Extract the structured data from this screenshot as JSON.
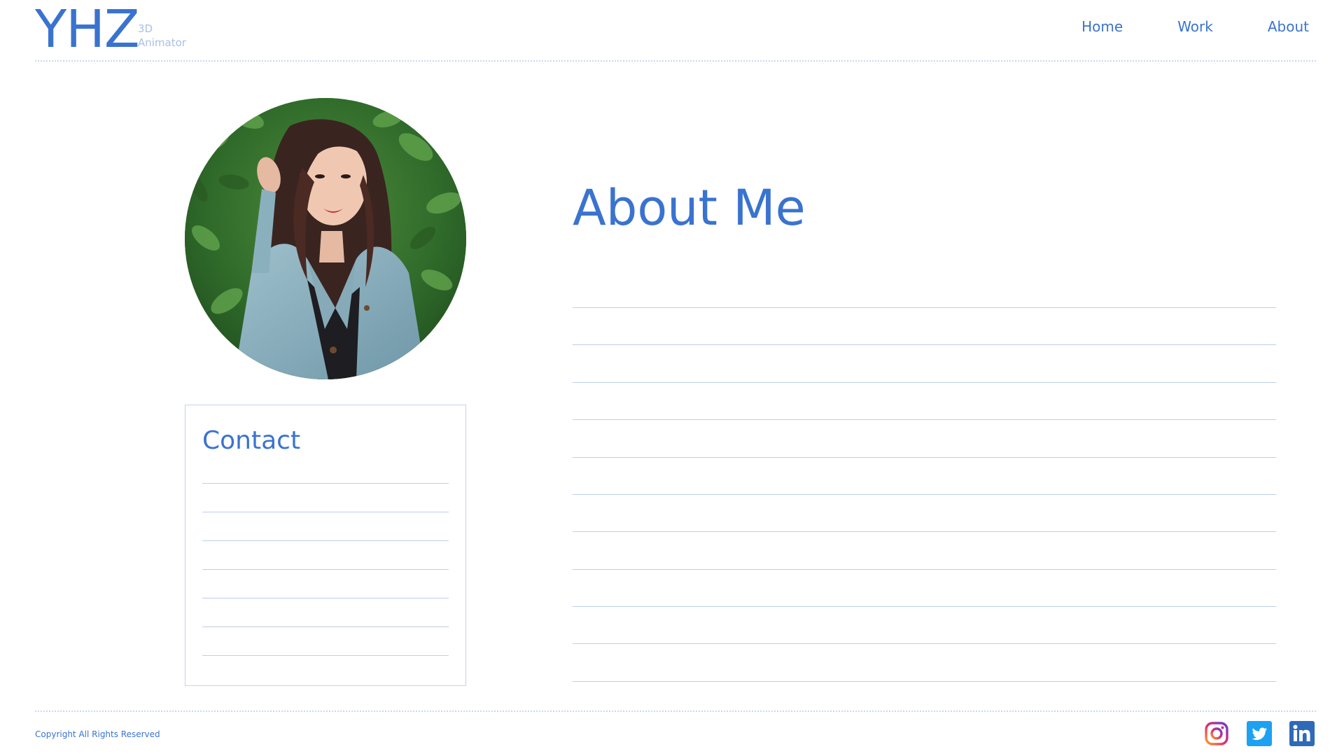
{
  "header": {
    "logo": "YHZ",
    "subtitle_line1": "3D",
    "subtitle_line2": "Animator",
    "nav": [
      {
        "label": "Home"
      },
      {
        "label": "Work"
      },
      {
        "label": "About"
      }
    ]
  },
  "contact": {
    "title": "Contact"
  },
  "about": {
    "title": "About Me"
  },
  "footer": {
    "copyright": "Copyright All Rights Reserved",
    "social": [
      {
        "icon": "instagram-icon"
      },
      {
        "icon": "twitter-icon"
      },
      {
        "icon": "linkedin-icon"
      }
    ]
  },
  "colors": {
    "accent": "#3a73cf",
    "subtitle": "#a8c0e6",
    "rule": "#bccfea"
  }
}
